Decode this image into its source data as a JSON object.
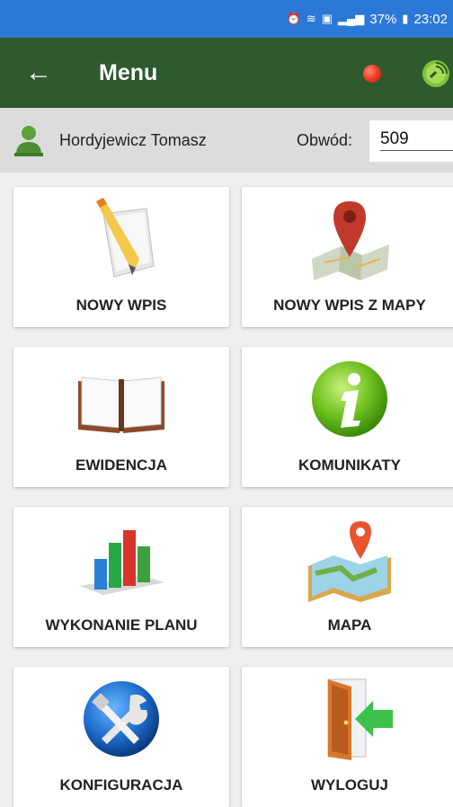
{
  "status_bar": {
    "battery": "37%",
    "time": "23:02"
  },
  "app_bar": {
    "title": "Menu"
  },
  "user_bar": {
    "user_name": "Hordyjewicz Tomasz",
    "district_label": "Obwód:",
    "district_value": "509"
  },
  "tiles": [
    {
      "label": "NOWY WPIS",
      "icon": "pencil-paper-icon"
    },
    {
      "label": "NOWY WPIS Z MAPY",
      "icon": "map-pin-icon"
    },
    {
      "label": "EWIDENCJA",
      "icon": "open-book-icon"
    },
    {
      "label": "KOMUNIKATY",
      "icon": "info-icon"
    },
    {
      "label": "WYKONANIE PLANU",
      "icon": "bar-chart-icon"
    },
    {
      "label": "MAPA",
      "icon": "folded-map-icon"
    },
    {
      "label": "KONFIGURACJA",
      "icon": "tools-icon"
    },
    {
      "label": "WYLOGUJ",
      "icon": "logout-door-icon"
    }
  ]
}
